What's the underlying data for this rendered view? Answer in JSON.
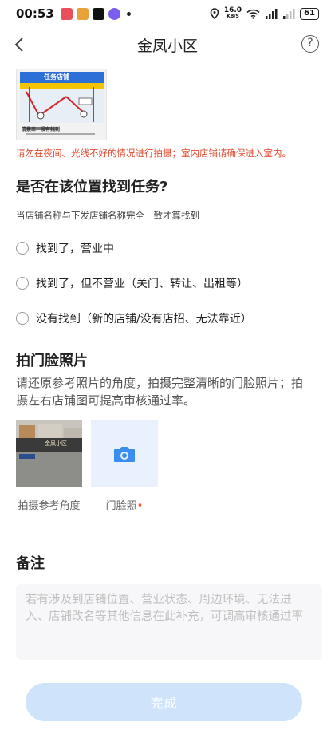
{
  "status_bar": {
    "time": "00:53",
    "network_speed": "16.0",
    "network_unit": "KB/S",
    "battery": "61"
  },
  "nav": {
    "title": "金凤小区",
    "help": "?"
  },
  "reference_illustration": {
    "sign_text": "任务店铺",
    "caption": "情景三：没有找到"
  },
  "warning": "请勿在夜间、光线不好的情况进行拍摄；室内店铺请确保进入室内。",
  "task_question": {
    "title": "是否在该位置找到任务?",
    "hint": "当店铺名称与下发店铺名称完全一致才算找到",
    "options": [
      "找到了，营业中",
      "找到了，但不营业（关门、转让、出租等）",
      "没有找到（新的店铺/没有店招、无法靠近）"
    ]
  },
  "storefront_photo": {
    "title": "拍门脸照片",
    "description": "请还原参考照片的角度，拍摄完整清晰的门脸照片；拍摄左右店铺图可提高审核通过率。",
    "reference_sign": "金凤小区",
    "reference_label": "拍摄参考角度",
    "upload_label": "门脸照",
    "required_mark": "•"
  },
  "remark": {
    "title": "备注",
    "placeholder": "若有涉及到店铺位置、营业状态、周边环境、无法进入、店铺改名等其他信息在此补充，可调高审核通过率"
  },
  "submit": {
    "label": "完成"
  },
  "colors": {
    "accent": "#3b8ef0",
    "warning": "#e04a2f",
    "button_disabled": "#cfe3fb",
    "upload_bg": "#e8f1fd"
  }
}
